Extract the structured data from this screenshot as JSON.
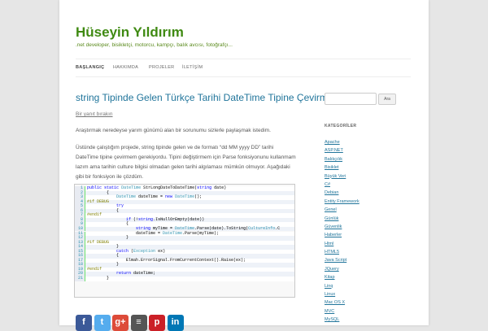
{
  "site": {
    "title": "Hüseyin Yıldırım",
    "description": ".net developer, bisikletçi, motorcu, kampçı, balık avcısı, fotoğrafçı..."
  },
  "nav": [
    "BAŞLANGIÇ",
    "HAKKIMDA",
    "PROJELER",
    "İLETİŞİM"
  ],
  "post": {
    "title": "string Tipinde Gelen Türkçe Tarihi DateTime Tipine Çevirmek",
    "reply_link": "Bir yanıt bırakın",
    "para1": "Araştırmak neredeyse yarım günümü alan bir sorunumu sizlerle paylaşmak istedim.",
    "para2": "Üstünde çalıştığım projede, string tipinde gelen ve de formatı “dd MM yyyy DD” tarihi DateTime tipine çevirmem gerekiyordu. Tipini değiştirmem için Parse fonksiyonunu kullanmam lazım ama tarihin culture bilgisi olmadan gelen tarihi algılaması mümkün olmuyor. Aşağıdaki gibi bir fonksiyon ile çözdüm."
  },
  "code": [
    {
      "n": "1",
      "t": "public static DateTime StrLongDateToDateTime(string date)"
    },
    {
      "n": "2",
      "t": "        {"
    },
    {
      "n": "3",
      "t": "            DateTime dateTime = new DateTime();"
    },
    {
      "n": "4",
      "t": "#if DEBUG"
    },
    {
      "n": "5",
      "t": "            try"
    },
    {
      "n": "6",
      "t": "            {"
    },
    {
      "n": "7",
      "t": "#endif"
    },
    {
      "n": "8",
      "t": "                if (!string.IsNullOrEmpty(date))"
    },
    {
      "n": "9",
      "t": "                {"
    },
    {
      "n": "10",
      "t": "                    string myTime = DateTime.Parse(date).ToString(CultureInfo.C"
    },
    {
      "n": "11",
      "t": "                    dateTime = DateTime.Parse(myTime);"
    },
    {
      "n": "12",
      "t": "                }"
    },
    {
      "n": "13",
      "t": "#if DEBUG"
    },
    {
      "n": "14",
      "t": "            }"
    },
    {
      "n": "15",
      "t": "            catch (Exception ex)"
    },
    {
      "n": "16",
      "t": "            {"
    },
    {
      "n": "17",
      "t": "                Elmah.ErrorSignal.FromCurrentContext().Raise(ex);"
    },
    {
      "n": "18",
      "t": "            }"
    },
    {
      "n": "19",
      "t": "#endif"
    },
    {
      "n": "20",
      "t": "            return dateTime;"
    },
    {
      "n": "21",
      "t": "        }"
    }
  ],
  "share": [
    {
      "icon": "facebook-icon",
      "glyph": "f",
      "color": "#3b5998"
    },
    {
      "icon": "twitter-icon",
      "glyph": "t",
      "color": "#55acee"
    },
    {
      "icon": "google-plus-icon",
      "glyph": "g+",
      "color": "#dd4b39"
    },
    {
      "icon": "delicious-icon",
      "glyph": "≡",
      "color": "#555555"
    },
    {
      "icon": "pinterest-icon",
      "glyph": "p",
      "color": "#cb2027"
    },
    {
      "icon": "linkedin-icon",
      "glyph": "in",
      "color": "#0077b5"
    }
  ],
  "sidebar": {
    "search_button": "Ara",
    "categories_title": "KATEGORİLER",
    "categories": [
      "Apache",
      "ASP.NET",
      "Balıkçılık",
      "Bisiklet",
      "Büyük Veri",
      "C#",
      "Debian",
      "Entity Framework",
      "Genel",
      "Günlük",
      "Güvenlik",
      "Haberler",
      "Html",
      "HTML5",
      "Java Script",
      "JQuery",
      "Kitap",
      "Linq",
      "Linux",
      "Mac OS X",
      "MVC",
      "MySQL"
    ]
  }
}
